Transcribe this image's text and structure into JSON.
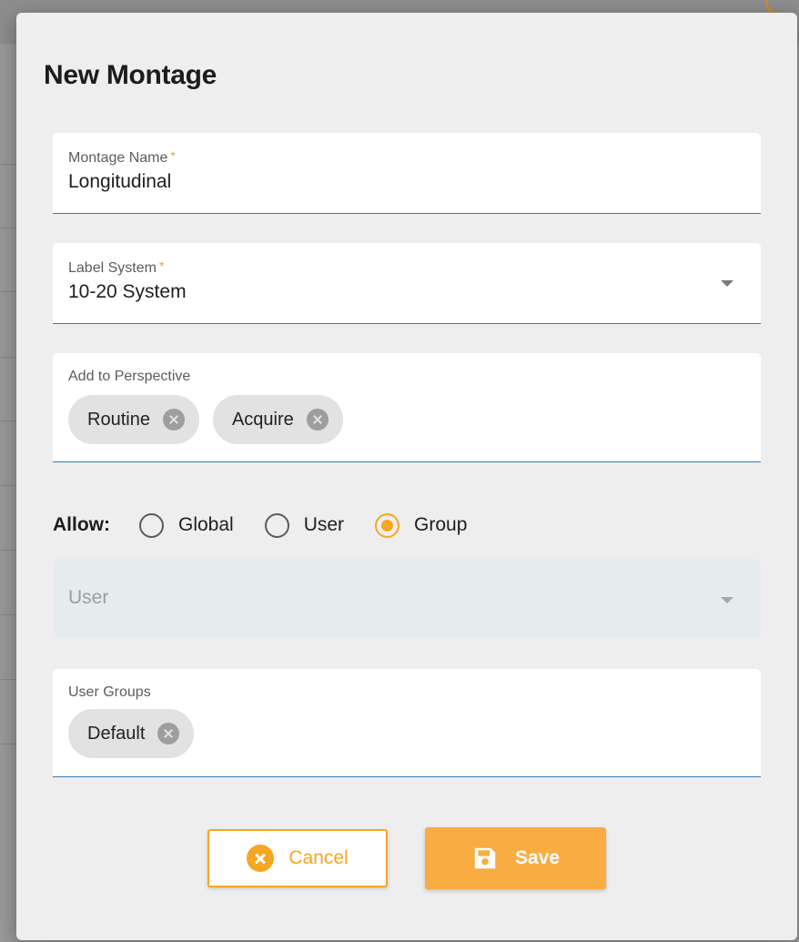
{
  "dialog": {
    "title": "New Montage"
  },
  "fields": {
    "montage_name": {
      "label": "Montage Name",
      "required_mark": "*",
      "value": "Longitudinal"
    },
    "label_system": {
      "label": "Label System",
      "required_mark": "*",
      "value": "10-20 System"
    },
    "add_to_perspective": {
      "label": "Add to Perspective",
      "chips": [
        {
          "label": "Routine"
        },
        {
          "label": "Acquire"
        }
      ]
    },
    "user": {
      "placeholder": "User",
      "disabled": true
    },
    "user_groups": {
      "label": "User Groups",
      "chips": [
        {
          "label": "Default"
        }
      ]
    }
  },
  "allow": {
    "label": "Allow:",
    "options": [
      {
        "label": "Global",
        "checked": false
      },
      {
        "label": "User",
        "checked": false
      },
      {
        "label": "Group",
        "checked": true
      }
    ]
  },
  "buttons": {
    "cancel": "Cancel",
    "save": "Save"
  },
  "colors": {
    "accent": "#f5a623",
    "save_button": "#f9ac42",
    "underline": "#2f7fb5",
    "dialog_bg": "#eeeeee"
  },
  "icons": [
    "chip-remove-icon",
    "dropdown-arrow-icon",
    "cancel-circle-icon",
    "save-floppy-icon"
  ]
}
